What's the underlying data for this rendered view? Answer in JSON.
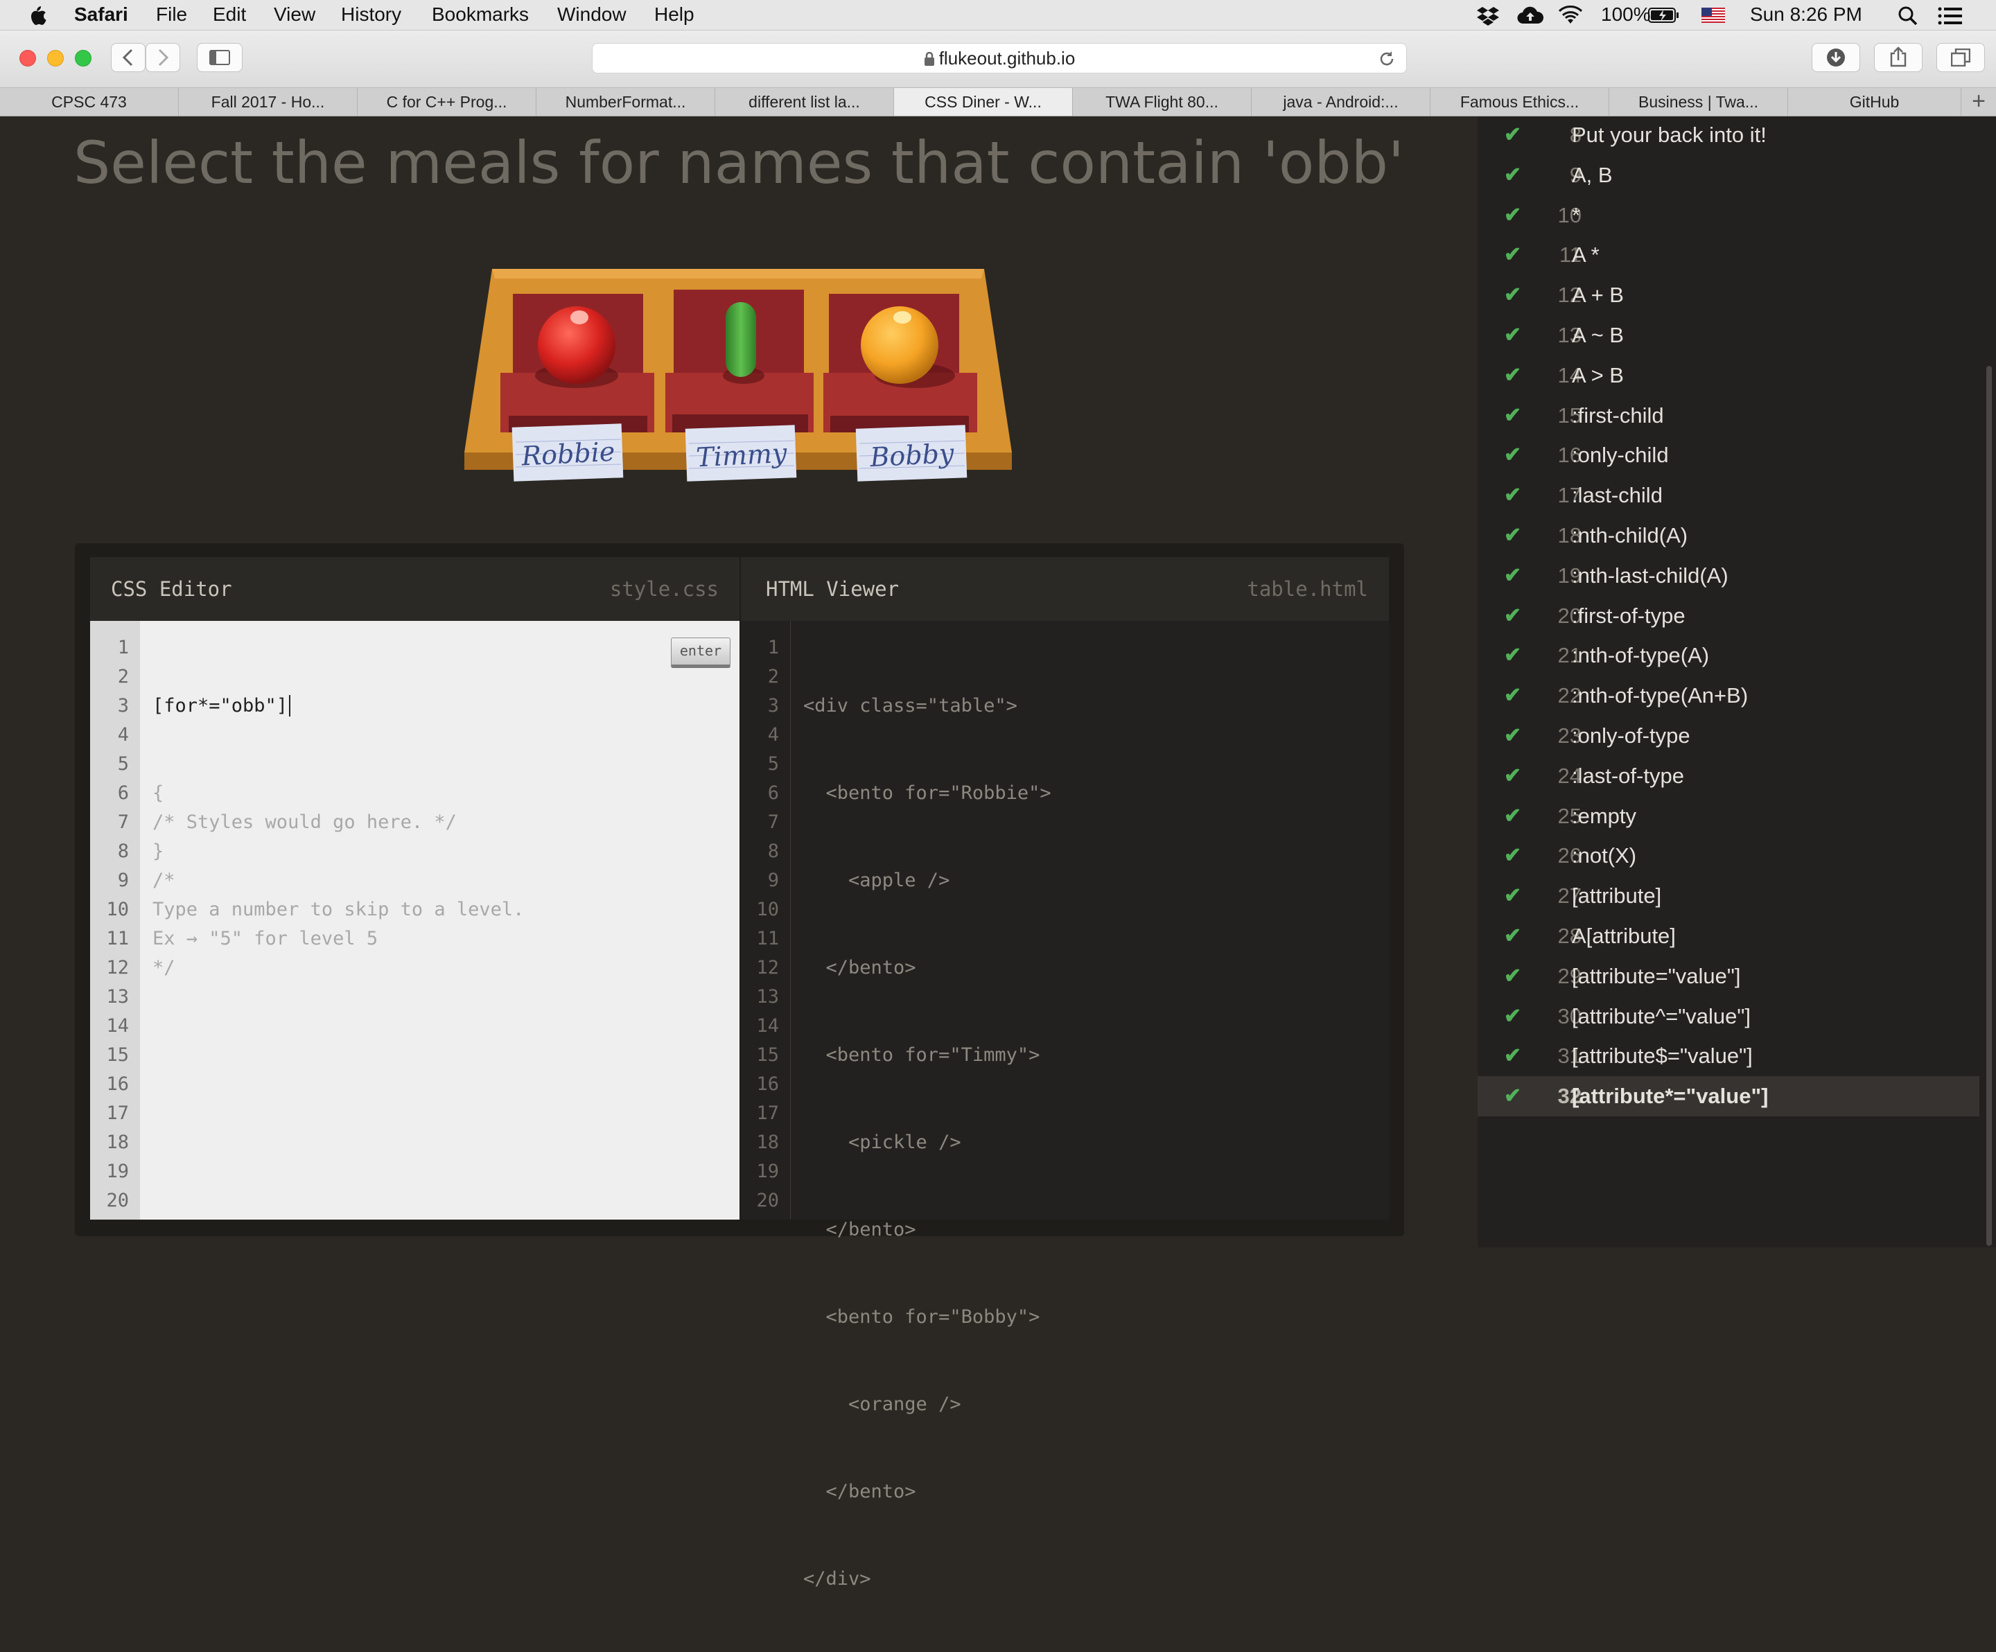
{
  "menubar": {
    "app": "Safari",
    "items": [
      "File",
      "Edit",
      "View",
      "History",
      "Bookmarks",
      "Window",
      "Help"
    ],
    "battery": "100%",
    "clock": "Sun 8:26 PM"
  },
  "browser": {
    "url": "flukeout.github.io",
    "tabs": [
      "CPSC 473",
      "Fall 2017 - Ho...",
      "C for C++ Prog...",
      "NumberFormat...",
      "different list la...",
      "CSS Diner - W...",
      "TWA Flight 80...",
      "java - Android:...",
      "Famous Ethics...",
      "Business | Twa...",
      "GitHub"
    ],
    "active_tab": 5,
    "new_tab": "+"
  },
  "game": {
    "instruction": "Select the meals for names that contain 'obb'",
    "names": [
      "Robbie",
      "Timmy",
      "Bobby"
    ]
  },
  "css_editor": {
    "title": "CSS Editor",
    "filename": "style.css",
    "enter_label": "enter",
    "input": "[for*=\"obb\"]",
    "lines": [
      "{",
      "/* Styles would go here. */",
      "}",
      "",
      "/*",
      "Type a number to skip to a level.",
      "Ex → \"5\" for level 5",
      "*/"
    ],
    "line_numbers": [
      "1",
      "2",
      "3",
      "4",
      "5",
      "6",
      "7",
      "8",
      "9",
      "10",
      "11",
      "12",
      "13",
      "14",
      "15",
      "16",
      "17",
      "18",
      "19",
      "20"
    ]
  },
  "html_viewer": {
    "title": "HTML Viewer",
    "filename": "table.html",
    "lines": [
      "<div class=\"table\">",
      "  <bento for=\"Robbie\">",
      "    <apple />",
      "  </bento>",
      "  <bento for=\"Timmy\">",
      "    <pickle />",
      "  </bento>",
      "  <bento for=\"Bobby\">",
      "    <orange />",
      "  </bento>",
      "</div>"
    ]
  },
  "levels": [
    {
      "num": "8",
      "name": "Put your back into it!",
      "done": true
    },
    {
      "num": "9",
      "name": "A, B",
      "done": true
    },
    {
      "num": "10",
      "name": "*",
      "done": true
    },
    {
      "num": "11",
      "name": "A *",
      "done": true
    },
    {
      "num": "12",
      "name": "A + B",
      "done": true
    },
    {
      "num": "13",
      "name": "A ~ B",
      "done": true
    },
    {
      "num": "14",
      "name": "A > B",
      "done": true
    },
    {
      "num": "15",
      "name": ":first-child",
      "done": true
    },
    {
      "num": "16",
      "name": ":only-child",
      "done": true
    },
    {
      "num": "17",
      "name": ":last-child",
      "done": true
    },
    {
      "num": "18",
      "name": ":nth-child(A)",
      "done": true
    },
    {
      "num": "19",
      "name": ":nth-last-child(A)",
      "done": true
    },
    {
      "num": "20",
      "name": ":first-of-type",
      "done": true
    },
    {
      "num": "21",
      "name": ":nth-of-type(A)",
      "done": true
    },
    {
      "num": "22",
      "name": ":nth-of-type(An+B)",
      "done": true
    },
    {
      "num": "23",
      "name": ":only-of-type",
      "done": true
    },
    {
      "num": "24",
      "name": ":last-of-type",
      "done": true
    },
    {
      "num": "25",
      "name": ":empty",
      "done": true
    },
    {
      "num": "26",
      "name": ":not(X)",
      "done": true
    },
    {
      "num": "27",
      "name": "[attribute]",
      "done": true
    },
    {
      "num": "28",
      "name": "A[attribute]",
      "done": true
    },
    {
      "num": "29",
      "name": "[attribute=\"value\"]",
      "done": true
    },
    {
      "num": "30",
      "name": "[attribute^=\"value\"]",
      "done": true
    },
    {
      "num": "31",
      "name": "[attribute$=\"value\"]",
      "done": true
    },
    {
      "num": "32",
      "name": "[attribute*=\"value\"]",
      "done": true,
      "current": true
    }
  ],
  "colors": {
    "accent_green": "#52b158",
    "bg": "#2b2823",
    "sidebar_bg": "#232120"
  }
}
